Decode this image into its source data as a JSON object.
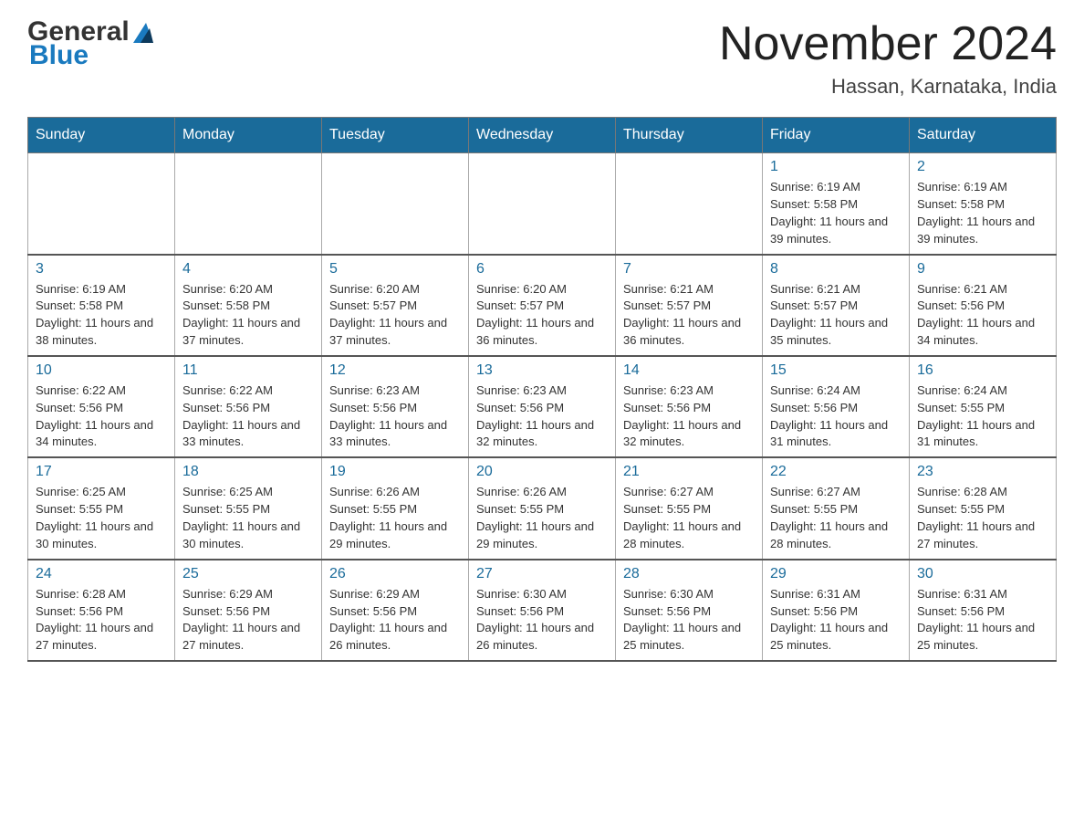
{
  "header": {
    "month_title": "November 2024",
    "location": "Hassan, Karnataka, India",
    "logo_general": "General",
    "logo_blue": "Blue"
  },
  "calendar": {
    "days_of_week": [
      "Sunday",
      "Monday",
      "Tuesday",
      "Wednesday",
      "Thursday",
      "Friday",
      "Saturday"
    ],
    "weeks": [
      [
        {
          "day": "",
          "info": ""
        },
        {
          "day": "",
          "info": ""
        },
        {
          "day": "",
          "info": ""
        },
        {
          "day": "",
          "info": ""
        },
        {
          "day": "",
          "info": ""
        },
        {
          "day": "1",
          "info": "Sunrise: 6:19 AM\nSunset: 5:58 PM\nDaylight: 11 hours and 39 minutes."
        },
        {
          "day": "2",
          "info": "Sunrise: 6:19 AM\nSunset: 5:58 PM\nDaylight: 11 hours and 39 minutes."
        }
      ],
      [
        {
          "day": "3",
          "info": "Sunrise: 6:19 AM\nSunset: 5:58 PM\nDaylight: 11 hours and 38 minutes."
        },
        {
          "day": "4",
          "info": "Sunrise: 6:20 AM\nSunset: 5:58 PM\nDaylight: 11 hours and 37 minutes."
        },
        {
          "day": "5",
          "info": "Sunrise: 6:20 AM\nSunset: 5:57 PM\nDaylight: 11 hours and 37 minutes."
        },
        {
          "day": "6",
          "info": "Sunrise: 6:20 AM\nSunset: 5:57 PM\nDaylight: 11 hours and 36 minutes."
        },
        {
          "day": "7",
          "info": "Sunrise: 6:21 AM\nSunset: 5:57 PM\nDaylight: 11 hours and 36 minutes."
        },
        {
          "day": "8",
          "info": "Sunrise: 6:21 AM\nSunset: 5:57 PM\nDaylight: 11 hours and 35 minutes."
        },
        {
          "day": "9",
          "info": "Sunrise: 6:21 AM\nSunset: 5:56 PM\nDaylight: 11 hours and 34 minutes."
        }
      ],
      [
        {
          "day": "10",
          "info": "Sunrise: 6:22 AM\nSunset: 5:56 PM\nDaylight: 11 hours and 34 minutes."
        },
        {
          "day": "11",
          "info": "Sunrise: 6:22 AM\nSunset: 5:56 PM\nDaylight: 11 hours and 33 minutes."
        },
        {
          "day": "12",
          "info": "Sunrise: 6:23 AM\nSunset: 5:56 PM\nDaylight: 11 hours and 33 minutes."
        },
        {
          "day": "13",
          "info": "Sunrise: 6:23 AM\nSunset: 5:56 PM\nDaylight: 11 hours and 32 minutes."
        },
        {
          "day": "14",
          "info": "Sunrise: 6:23 AM\nSunset: 5:56 PM\nDaylight: 11 hours and 32 minutes."
        },
        {
          "day": "15",
          "info": "Sunrise: 6:24 AM\nSunset: 5:56 PM\nDaylight: 11 hours and 31 minutes."
        },
        {
          "day": "16",
          "info": "Sunrise: 6:24 AM\nSunset: 5:55 PM\nDaylight: 11 hours and 31 minutes."
        }
      ],
      [
        {
          "day": "17",
          "info": "Sunrise: 6:25 AM\nSunset: 5:55 PM\nDaylight: 11 hours and 30 minutes."
        },
        {
          "day": "18",
          "info": "Sunrise: 6:25 AM\nSunset: 5:55 PM\nDaylight: 11 hours and 30 minutes."
        },
        {
          "day": "19",
          "info": "Sunrise: 6:26 AM\nSunset: 5:55 PM\nDaylight: 11 hours and 29 minutes."
        },
        {
          "day": "20",
          "info": "Sunrise: 6:26 AM\nSunset: 5:55 PM\nDaylight: 11 hours and 29 minutes."
        },
        {
          "day": "21",
          "info": "Sunrise: 6:27 AM\nSunset: 5:55 PM\nDaylight: 11 hours and 28 minutes."
        },
        {
          "day": "22",
          "info": "Sunrise: 6:27 AM\nSunset: 5:55 PM\nDaylight: 11 hours and 28 minutes."
        },
        {
          "day": "23",
          "info": "Sunrise: 6:28 AM\nSunset: 5:55 PM\nDaylight: 11 hours and 27 minutes."
        }
      ],
      [
        {
          "day": "24",
          "info": "Sunrise: 6:28 AM\nSunset: 5:56 PM\nDaylight: 11 hours and 27 minutes."
        },
        {
          "day": "25",
          "info": "Sunrise: 6:29 AM\nSunset: 5:56 PM\nDaylight: 11 hours and 27 minutes."
        },
        {
          "day": "26",
          "info": "Sunrise: 6:29 AM\nSunset: 5:56 PM\nDaylight: 11 hours and 26 minutes."
        },
        {
          "day": "27",
          "info": "Sunrise: 6:30 AM\nSunset: 5:56 PM\nDaylight: 11 hours and 26 minutes."
        },
        {
          "day": "28",
          "info": "Sunrise: 6:30 AM\nSunset: 5:56 PM\nDaylight: 11 hours and 25 minutes."
        },
        {
          "day": "29",
          "info": "Sunrise: 6:31 AM\nSunset: 5:56 PM\nDaylight: 11 hours and 25 minutes."
        },
        {
          "day": "30",
          "info": "Sunrise: 6:31 AM\nSunset: 5:56 PM\nDaylight: 11 hours and 25 minutes."
        }
      ]
    ]
  }
}
